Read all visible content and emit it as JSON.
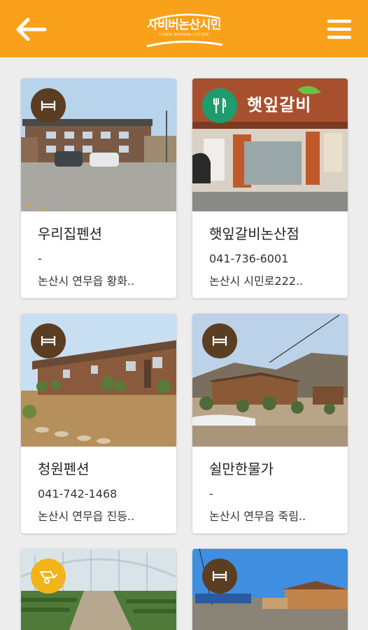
{
  "header": {
    "logo_main": "사비버논산시민",
    "logo_sub": "CYBER NONSAN CITIZEN"
  },
  "colors": {
    "accent": "#f9a11b",
    "badge_lodging": "#5b3d22",
    "badge_food": "#1e9c6e",
    "badge_farm": "#f2b418"
  },
  "listings": [
    {
      "name": "우리집펜션",
      "phone": "-",
      "address": "논산시 연무읍 황화..",
      "category_icon": "bed-icon"
    },
    {
      "name": "햇잎갈비논산점",
      "phone": "041-736-6001",
      "address": "논산시 시민로222..",
      "category_icon": "fork-knife-icon",
      "sign_text": "햇잎갈비"
    },
    {
      "name": "청원펜션",
      "phone": "041-742-1468",
      "address": "논산시 연무읍 진등..",
      "category_icon": "bed-icon"
    },
    {
      "name": "쉴만한물가",
      "phone": "-",
      "address": "논산시 연무읍 죽림..",
      "category_icon": "bed-icon"
    },
    {
      "category_icon": "wheelbarrow-icon"
    },
    {
      "category_icon": "bed-icon"
    }
  ]
}
